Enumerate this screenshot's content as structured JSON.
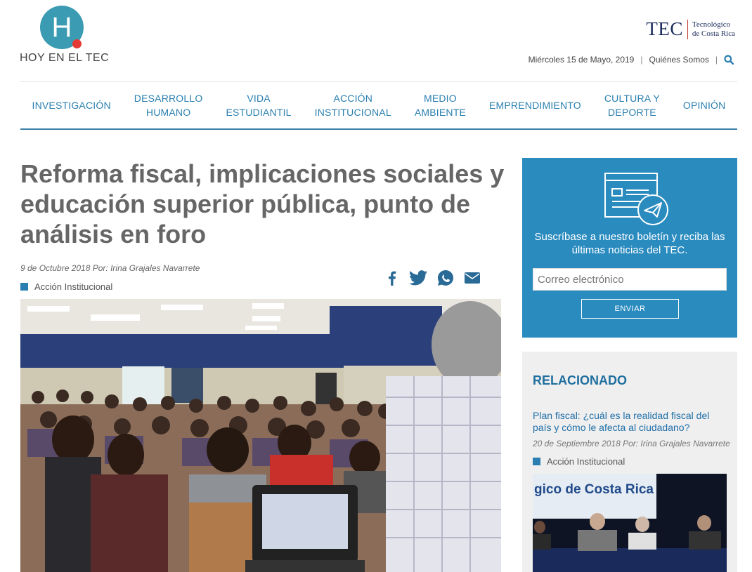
{
  "brand": {
    "logo_letter": "H",
    "logo_text": "HOY EN EL TEC",
    "partner_word": "TEC",
    "partner_sub_line1": "Tecnológico",
    "partner_sub_line2": "de Costa Rica"
  },
  "topbar": {
    "date": "Miércoles 15 de Mayo, 2019",
    "about_link": "Quiénes Somos",
    "separator": "|",
    "search_icon": "search-icon"
  },
  "nav": {
    "items": [
      {
        "line1": "INVESTIGACIÓN",
        "line2": ""
      },
      {
        "line1": "DESARROLLO",
        "line2": "HUMANO"
      },
      {
        "line1": "VIDA",
        "line2": "ESTUDIANTIL"
      },
      {
        "line1": "ACCIÓN",
        "line2": "INSTITUCIONAL"
      },
      {
        "line1": "MEDIO",
        "line2": "AMBIENTE"
      },
      {
        "line1": "EMPRENDIMIENTO",
        "line2": ""
      },
      {
        "line1": "CULTURA Y",
        "line2": "DEPORTE"
      },
      {
        "line1": "OPINIÓN",
        "line2": ""
      }
    ]
  },
  "article": {
    "title": "Reforma fiscal, implicaciones sociales y educación superior pública, punto de análisis en foro",
    "meta": "9 de Octubre 2018 Por: Irina Grajales Navarrete",
    "category": "Acción Institucional",
    "share_icons": [
      "facebook-icon",
      "twitter-icon",
      "whatsapp-icon",
      "email-icon"
    ]
  },
  "newsletter": {
    "text": "Suscríbase a nuestro boletín y reciba las últimas noticias del TEC.",
    "placeholder": "Correo electrónico",
    "button": "ENVIAR"
  },
  "related": {
    "heading": "RELACIONADO",
    "title": "Plan fiscal: ¿cuál es la realidad fiscal del país y cómo le afecta al ciudadano?",
    "meta": "20 de Septiembre 2018 Por: Irina Grajales Navarrete",
    "category": "Acción Institucional",
    "image_banner": "gico de Costa Rica"
  },
  "colors": {
    "accent": "#2a7fb0",
    "newsletter_bg": "#2a8bbf",
    "logo_teal": "#3a9bb3",
    "logo_red": "#e53935"
  }
}
